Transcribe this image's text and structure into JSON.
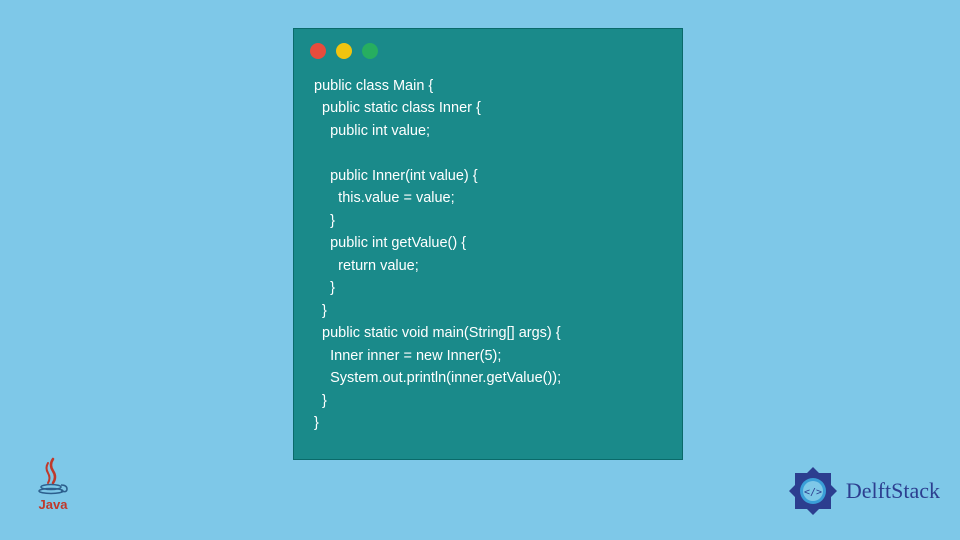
{
  "code": {
    "lines": [
      "public class Main {",
      "  public static class Inner {",
      "    public int value;",
      "",
      "    public Inner(int value) {",
      "      this.value = value;",
      "    }",
      "    public int getValue() {",
      "      return value;",
      "    }",
      "  }",
      "  public static void main(String[] args) {",
      "    Inner inner = new Inner(5);",
      "    System.out.println(inner.getValue());",
      "  }",
      "}"
    ]
  },
  "logos": {
    "java_label": "Java",
    "delft_label": "DelftStack"
  }
}
